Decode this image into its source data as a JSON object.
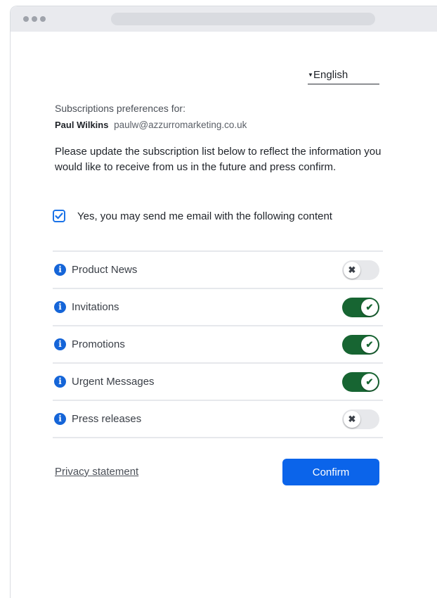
{
  "language": {
    "caret_icon": "caret-down-icon",
    "label": "English"
  },
  "header": {
    "preferences_for": "Subscriptions preferences for:",
    "user_name": "Paul Wilkins",
    "user_email": "paulw@azzurromarketing.co.uk"
  },
  "intro_text": "Please update the subscription list below to reflect the information you would like to receive from us in the future and press confirm.",
  "consent": {
    "label": "Yes, you may send me email with the following content",
    "checked": true,
    "check_glyph": "✔"
  },
  "subscriptions": [
    {
      "label": "Product News",
      "enabled": false,
      "glyph": "✖"
    },
    {
      "label": "Invitations",
      "enabled": true,
      "glyph": "✔"
    },
    {
      "label": "Promotions",
      "enabled": true,
      "glyph": "✔"
    },
    {
      "label": "Urgent Messages",
      "enabled": true,
      "glyph": "✔"
    },
    {
      "label": "Press releases",
      "enabled": false,
      "glyph": "✖"
    }
  ],
  "info_glyph": "i",
  "footer": {
    "privacy_label": "Privacy statement",
    "confirm_label": "Confirm"
  },
  "colors": {
    "accent_blue": "#0b64ea",
    "toggle_on": "#176532",
    "toggle_off": "#e7e8eb"
  }
}
